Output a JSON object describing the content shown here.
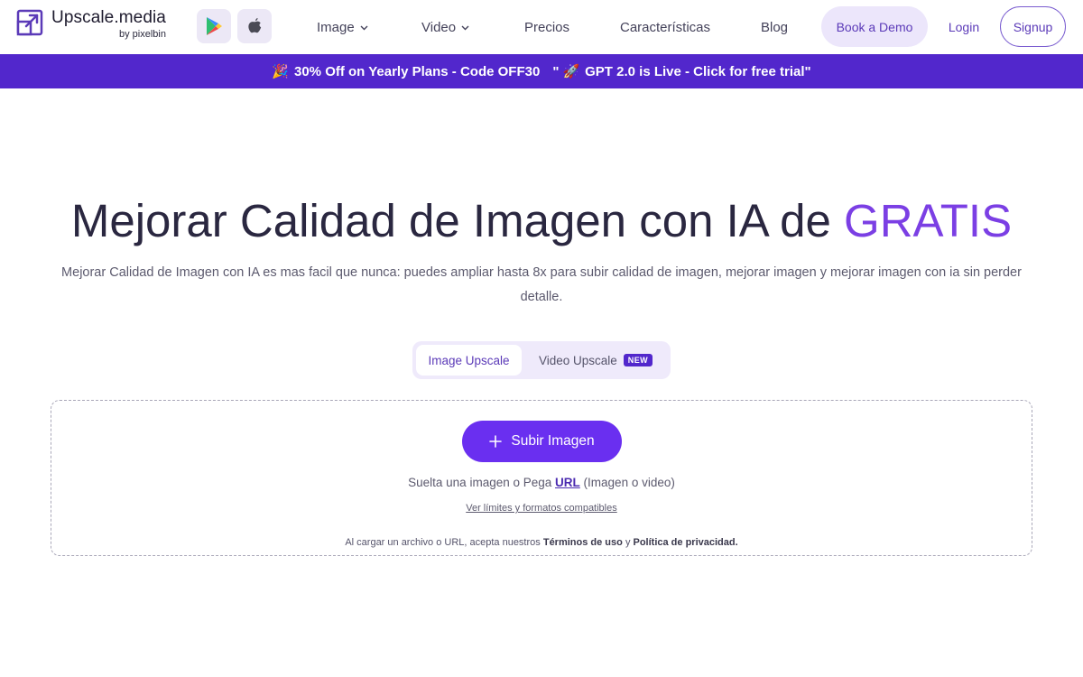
{
  "header": {
    "brand_name": "Upscale.media",
    "brand_sub": "by pixelbin",
    "nav": [
      {
        "label": "Image",
        "has_dropdown": true
      },
      {
        "label": "Video",
        "has_dropdown": true
      },
      {
        "label": "Precios",
        "has_dropdown": false
      },
      {
        "label": "Características",
        "has_dropdown": false
      },
      {
        "label": "Blog",
        "has_dropdown": false
      }
    ],
    "book_demo": "Book a Demo",
    "login": "Login",
    "signup": "Signup"
  },
  "banner": {
    "emoji_1": "🎉",
    "offer": "30% Off on Yearly Plans - Code OFF30",
    "quote_open": "\"",
    "emoji_2": "🚀",
    "gpt": "GPT 2.0 is Live - Click for free trial\""
  },
  "hero": {
    "title_main": "Mejorar Calidad de Imagen con IA de",
    "title_accent": "GRATIS",
    "subtitle": "Mejorar Calidad de Imagen con IA es mas facil que nunca: puedes ampliar hasta 8x para subir calidad de imagen, mejorar imagen y mejorar imagen con ia sin perder detalle."
  },
  "tabs": {
    "image": "Image Upscale",
    "video": "Video Upscale",
    "new_badge": "NEW"
  },
  "dropzone": {
    "upload_button": "Subir Imagen",
    "hint_before": "Suelta una imagen o Pega",
    "hint_url": "URL",
    "hint_after": "(Imagen o video)",
    "limits_link": "Ver límites y formatos compatibles",
    "terms_before": "Al cargar un archivo o URL, acepta nuestros",
    "terms_link": "Términos de uso",
    "terms_and": "y",
    "privacy_link": "Política de privacidad",
    "terms_end": "."
  },
  "colors": {
    "brand_purple": "#5227cc",
    "accent_purple": "#7b3fe4",
    "button_purple": "#6a2ff0",
    "light_lavender": "#ece6fb"
  }
}
